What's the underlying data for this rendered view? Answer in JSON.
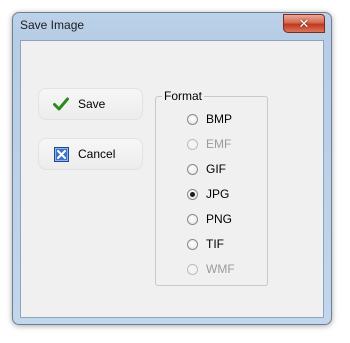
{
  "window": {
    "title": "Save Image",
    "close_symbol": "✕"
  },
  "buttons": {
    "save_label": "Save",
    "cancel_label": "Cancel"
  },
  "format": {
    "legend": "Format",
    "options": [
      {
        "label": "BMP",
        "enabled": true,
        "selected": false
      },
      {
        "label": "EMF",
        "enabled": false,
        "selected": false
      },
      {
        "label": "GIF",
        "enabled": true,
        "selected": false
      },
      {
        "label": "JPG",
        "enabled": true,
        "selected": true
      },
      {
        "label": "PNG",
        "enabled": true,
        "selected": false
      },
      {
        "label": "TIF",
        "enabled": true,
        "selected": false
      },
      {
        "label": "WMF",
        "enabled": false,
        "selected": false
      }
    ]
  },
  "colors": {
    "title_gradient": "#bcd2ea",
    "client_bg": "#f0f0f0",
    "close_red": "#c0391f",
    "check_green": "#2d8a1f",
    "cancel_blue": "#2a5fb0"
  }
}
